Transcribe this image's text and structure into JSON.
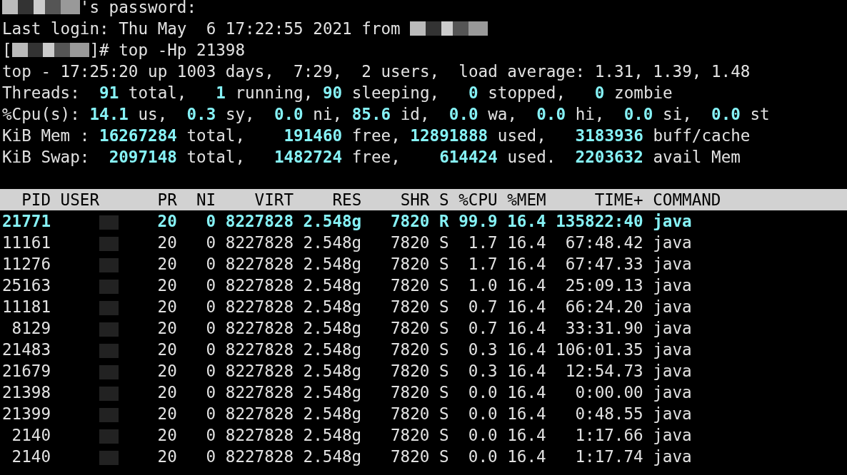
{
  "terminal_lines": [
    {
      "segments": [
        {
          "kind": "redacted"
        },
        {
          "kind": "text",
          "text": "'s password:"
        }
      ]
    },
    {
      "segments": [
        {
          "kind": "text",
          "text": "Last login: Thu May  6 17:22:55 2021 from "
        },
        {
          "kind": "redacted"
        }
      ]
    },
    {
      "segments": [
        {
          "kind": "text",
          "text": "["
        },
        {
          "kind": "redacted"
        },
        {
          "kind": "text",
          "text": "]# top -Hp 21398"
        }
      ]
    },
    {
      "segments": [
        {
          "kind": "text",
          "text": "top - 17:25:20 up 1003 days,  7:29,  2 users,  load average: 1.31, 1.39, 1.48"
        }
      ]
    },
    {
      "segments": [
        {
          "kind": "text",
          "text": "Threads: "
        },
        {
          "kind": "value",
          "text": " 91"
        },
        {
          "kind": "text",
          "text": " total,  "
        },
        {
          "kind": "value",
          "text": " 1"
        },
        {
          "kind": "text",
          "text": " running, "
        },
        {
          "kind": "value",
          "text": "90"
        },
        {
          "kind": "text",
          "text": " sleeping,  "
        },
        {
          "kind": "value",
          "text": " 0"
        },
        {
          "kind": "text",
          "text": " stopped,  "
        },
        {
          "kind": "value",
          "text": " 0"
        },
        {
          "kind": "text",
          "text": " zombie"
        }
      ]
    },
    {
      "segments": [
        {
          "kind": "text",
          "text": "%Cpu(s):"
        },
        {
          "kind": "value",
          "text": " 14.1"
        },
        {
          "kind": "text",
          "text": " us, "
        },
        {
          "kind": "value",
          "text": " 0.3"
        },
        {
          "kind": "text",
          "text": " sy, "
        },
        {
          "kind": "value",
          "text": " 0.0"
        },
        {
          "kind": "text",
          "text": " ni,"
        },
        {
          "kind": "value",
          "text": " 85.6"
        },
        {
          "kind": "text",
          "text": " id, "
        },
        {
          "kind": "value",
          "text": " 0.0"
        },
        {
          "kind": "text",
          "text": " wa, "
        },
        {
          "kind": "value",
          "text": " 0.0"
        },
        {
          "kind": "text",
          "text": " hi, "
        },
        {
          "kind": "value",
          "text": " 0.0"
        },
        {
          "kind": "text",
          "text": " si, "
        },
        {
          "kind": "value",
          "text": " 0.0"
        },
        {
          "kind": "text",
          "text": " st"
        }
      ]
    },
    {
      "segments": [
        {
          "kind": "text",
          "text": "KiB Mem : "
        },
        {
          "kind": "value",
          "text": "16267284"
        },
        {
          "kind": "text",
          "text": " total,  "
        },
        {
          "kind": "value",
          "text": "  191460"
        },
        {
          "kind": "text",
          "text": " free, "
        },
        {
          "kind": "value",
          "text": "12891888"
        },
        {
          "kind": "text",
          "text": " used,  "
        },
        {
          "kind": "value",
          "text": " 3183936"
        },
        {
          "kind": "text",
          "text": " buff/cache"
        }
      ]
    },
    {
      "segments": [
        {
          "kind": "text",
          "text": "KiB Swap: "
        },
        {
          "kind": "value",
          "text": " 2097148"
        },
        {
          "kind": "text",
          "text": " total,  "
        },
        {
          "kind": "value",
          "text": " 1482724"
        },
        {
          "kind": "text",
          "text": " free,  "
        },
        {
          "kind": "value",
          "text": "  614424"
        },
        {
          "kind": "text",
          "text": " used.  "
        },
        {
          "kind": "value",
          "text": "2203632"
        },
        {
          "kind": "text",
          "text": " avail Mem"
        }
      ]
    }
  ],
  "process_table": {
    "columns": [
      "PID",
      "USER",
      "PR",
      "NI",
      "VIRT",
      "RES",
      "SHR",
      "S",
      "%CPU",
      "%MEM",
      "TIME+",
      "COMMAND"
    ],
    "rows": [
      {
        "running": true,
        "cells": [
          "21771",
          "",
          "20",
          "0",
          "8227828",
          "2.548g",
          "7820",
          "R",
          "99.9",
          "16.4",
          "135822:40",
          "java"
        ]
      },
      {
        "running": false,
        "cells": [
          "11161",
          "",
          "20",
          "0",
          "8227828",
          "2.548g",
          "7820",
          "S",
          "1.7",
          "16.4",
          "67:48.42",
          "java"
        ]
      },
      {
        "running": false,
        "cells": [
          "11276",
          "",
          "20",
          "0",
          "8227828",
          "2.548g",
          "7820",
          "S",
          "1.7",
          "16.4",
          "67:47.33",
          "java"
        ]
      },
      {
        "running": false,
        "cells": [
          "25163",
          "",
          "20",
          "0",
          "8227828",
          "2.548g",
          "7820",
          "S",
          "1.0",
          "16.4",
          "25:09.13",
          "java"
        ]
      },
      {
        "running": false,
        "cells": [
          "11181",
          "",
          "20",
          "0",
          "8227828",
          "2.548g",
          "7820",
          "S",
          "0.7",
          "16.4",
          "66:24.20",
          "java"
        ]
      },
      {
        "running": false,
        "cells": [
          "8129",
          "",
          "20",
          "0",
          "8227828",
          "2.548g",
          "7820",
          "S",
          "0.7",
          "16.4",
          "33:31.90",
          "java"
        ]
      },
      {
        "running": false,
        "cells": [
          "21483",
          "",
          "20",
          "0",
          "8227828",
          "2.548g",
          "7820",
          "S",
          "0.3",
          "16.4",
          "106:01.35",
          "java"
        ]
      },
      {
        "running": false,
        "cells": [
          "21679",
          "",
          "20",
          "0",
          "8227828",
          "2.548g",
          "7820",
          "S",
          "0.3",
          "16.4",
          "12:54.73",
          "java"
        ]
      },
      {
        "running": false,
        "cells": [
          "21398",
          "",
          "20",
          "0",
          "8227828",
          "2.548g",
          "7820",
          "S",
          "0.0",
          "16.4",
          "0:00.00",
          "java"
        ]
      },
      {
        "running": false,
        "cells": [
          "21399",
          "",
          "20",
          "0",
          "8227828",
          "2.548g",
          "7820",
          "S",
          "0.0",
          "16.4",
          "0:48.55",
          "java"
        ]
      },
      {
        "running": false,
        "cells": [
          "2140",
          "",
          "20",
          "0",
          "8227828",
          "2.548g",
          "7820",
          "S",
          "0.0",
          "16.4",
          "1:17.66",
          "java"
        ]
      },
      {
        "running": false,
        "cells": [
          "2140",
          "",
          "20",
          "0",
          "8227828",
          "2.548g",
          "7820",
          "S",
          "0.0",
          "16.4",
          "1:17.74",
          "java"
        ]
      }
    ]
  }
}
